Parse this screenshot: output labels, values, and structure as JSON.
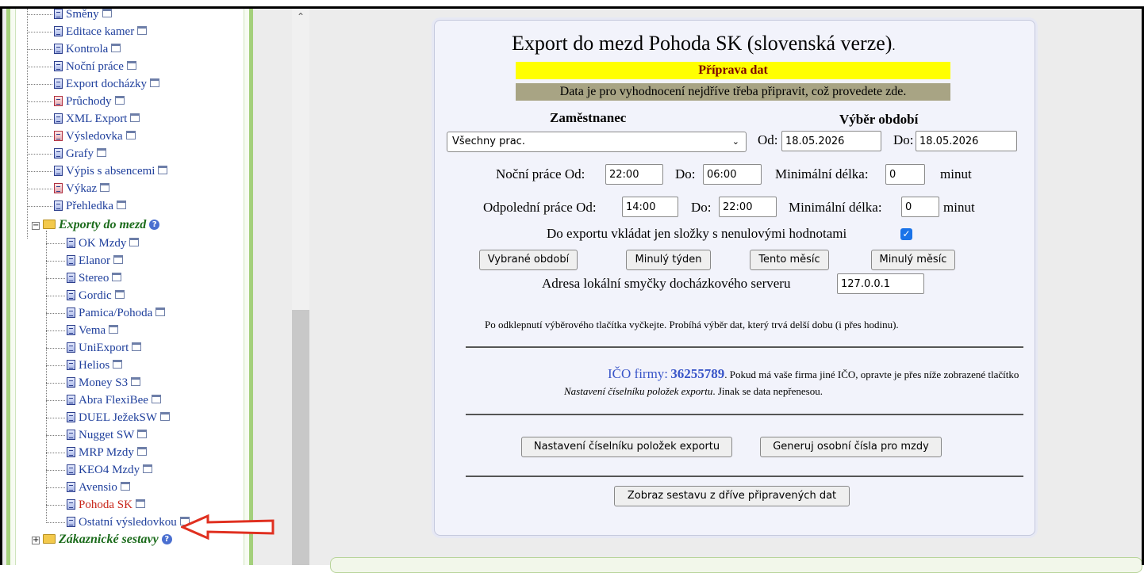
{
  "tree": {
    "items_top": [
      {
        "label": "Směny",
        "red_icon": false
      },
      {
        "label": "Editace kamer",
        "red_icon": false
      },
      {
        "label": "Kontrola",
        "red_icon": false
      },
      {
        "label": "Noční práce",
        "red_icon": false
      },
      {
        "label": "Export docházky",
        "red_icon": false
      },
      {
        "label": "Průchody",
        "red_icon": true
      },
      {
        "label": "XML Export",
        "red_icon": false
      },
      {
        "label": "Výsledovka",
        "red_icon": true
      },
      {
        "label": "Grafy",
        "red_icon": false
      },
      {
        "label": "Výpis s absencemi",
        "red_icon": false
      },
      {
        "label": "Výkaz",
        "red_icon": true
      },
      {
        "label": "Přehledka",
        "red_icon": false
      }
    ],
    "folder_label": "Exporty do mezd",
    "folder_items": [
      "OK Mzdy",
      "Elanor",
      "Stereo",
      "Gordic",
      "Pamica/Pohoda",
      "Vema",
      "UniExport",
      "Helios",
      "Money S3",
      "Abra FlexiBee",
      "DUEL JežekSW",
      "Nugget SW",
      "MRP Mzdy",
      "KEO4 Mzdy",
      "Avensio",
      "Pohoda SK",
      "Ostatní výsledovkou"
    ],
    "selected_item": "Pohoda SK",
    "next_folder_label": "Zákaznické sestavy"
  },
  "form": {
    "title": "Export do mezd Pohoda SK (slovenská verze)",
    "title_dot": ".",
    "prep_header": "Příprava dat",
    "prep_note": "Data je pro vyhodnocení nejdříve třeba připravit, což provedete zde.",
    "employee_label": "Zaměstnanec",
    "period_label": "Výběr období",
    "employee_value": "Všechny prac.",
    "from_label": "Od:",
    "from_value": "18.05.2026",
    "to_label": "Do:",
    "to_value": "18.05.2026",
    "night_label": "Noční práce Od:",
    "night_from": "22:00",
    "night_to_label": "Do:",
    "night_to": "06:00",
    "min_len_label": "Minimální délka:",
    "night_min": "0",
    "minutes_label": "minut",
    "afternoon_label": "Odpolední práce Od:",
    "afternoon_from": "14:00",
    "afternoon_to_label": "Do:",
    "afternoon_to": "22:00",
    "afternoon_min": "0",
    "nonzero_label": "Do exportu vkládat jen složky s nenulovými hodnotami",
    "nonzero_checked": true,
    "buttons_period": [
      "Vybrané období",
      "Minulý týden",
      "Tento měsíc",
      "Minulý měsíc"
    ],
    "loopback_label": "Adresa lokální smyčky docházkového serveru",
    "loopback_value": "127.0.0.1",
    "wait_note": "Po odklepnutí výběrového tlačítka vyčkejte. Probíhá výběr dat, který trvá delší dobu (i přes hodinu).",
    "ico_label": "IČO firmy:",
    "ico_value": "36255789",
    "ico_note_1": ". Pokud má vaše firma jiné IČO, opravte je přes níže zobrazené tlačítko",
    "ico_note_2_italic": "Nastavení číselníku položek exportu",
    "ico_note_2_rest": ". Jinak se data nepřenesou.",
    "btn_settings": "Nastavení číselníku položek exportu",
    "btn_generate": "Generuj osobní čísla pro mzdy",
    "btn_show": "Zobraz sestavu z dříve připravených dat"
  },
  "colors": {
    "tree_link": "#1f3f9c",
    "folder_text": "#1b6b1b",
    "selected_text": "#c8261a",
    "arrow": "#e03020",
    "prep_bar": "#ffff00",
    "note_bar": "#a8a484",
    "ico_text": "#3955c8"
  }
}
